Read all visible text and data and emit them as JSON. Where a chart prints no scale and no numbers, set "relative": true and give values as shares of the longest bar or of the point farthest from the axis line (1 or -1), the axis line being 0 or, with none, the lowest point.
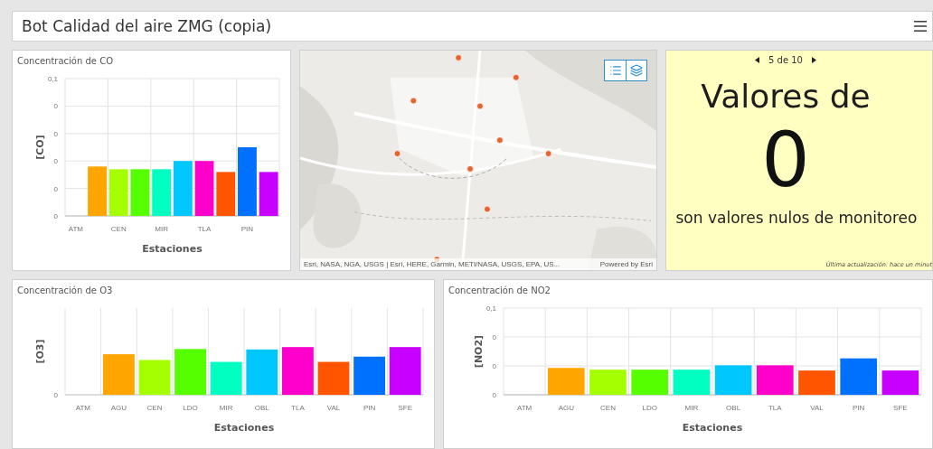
{
  "header": {
    "title": "Bot Calidad del aire ZMG (copia)"
  },
  "co_chart": {
    "title": "Concentración de CO",
    "chart_data": {
      "type": "bar",
      "xlabel": "Estaciones",
      "ylabel": "[CO]",
      "categories": [
        "ATM",
        null,
        "CEN",
        null,
        "MIR",
        null,
        "TLA",
        null,
        "PIN",
        null
      ],
      "series": [
        {
          "colors": [
            null,
            "#ffa500",
            "#a6ff00",
            "#55ff00",
            "#00ffc0",
            "#00c8ff",
            "#ff00cc",
            "#ff5500",
            "#0070ff",
            "#c800ff"
          ],
          "values": [
            null,
            0.036,
            0.034,
            0.034,
            0.034,
            0.04,
            0.04,
            0.032,
            0.05,
            0.032
          ]
        }
      ],
      "ylim": [
        0,
        0.1
      ],
      "yticks": [
        {
          "value": 0,
          "label": "0"
        },
        {
          "value": 0.02,
          "label": "0"
        },
        {
          "value": 0.04,
          "label": "0"
        },
        {
          "value": 0.06,
          "label": "0"
        },
        {
          "value": 0.08,
          "label": "0"
        },
        {
          "value": 0.1,
          "label": "0,1"
        }
      ],
      "grid": true
    }
  },
  "map": {
    "attribution": "Esri, NASA, NGA, USGS | Esri, HERE, Garmin, METI/NASA, USGS, EPA, US...",
    "powered_by": "Powered by Esri"
  },
  "indicator": {
    "pager": "5 de 10",
    "top_text": "Valores de",
    "value": "0",
    "bottom_text": "son valores nulos de monitoreo",
    "last_update": "Última actualización: hace un minut"
  },
  "o3_chart": {
    "title": "Concentración de O3",
    "chart_data": {
      "type": "bar",
      "xlabel": "Estaciones",
      "ylabel": "[O3]",
      "relative": true,
      "categories": [
        "ATM",
        "AGU",
        "CEN",
        "LDO",
        "MIR",
        "OBL",
        "TLA",
        "VAL",
        "PIN",
        "SFE"
      ],
      "series": [
        {
          "colors": [
            null,
            "#ffa500",
            "#a6ff00",
            "#55ff00",
            "#00ffc0",
            "#00c8ff",
            "#ff00cc",
            "#ff5500",
            "#0070ff",
            "#c800ff"
          ],
          "values": [
            null,
            0.85,
            0.73,
            0.96,
            0.69,
            0.95,
            1,
            0.69,
            0.8,
            1
          ]
        }
      ],
      "annotations": [
        {
          "text": "0"
        }
      ],
      "grid": true
    }
  },
  "no2_chart": {
    "title": "Concentración de NO2",
    "chart_data": {
      "type": "bar",
      "xlabel": "Estaciones",
      "ylabel": "[NO2]",
      "categories": [
        "ATM",
        "AGU",
        "CEN",
        "LDO",
        "MIR",
        "OBL",
        "TLA",
        "VAL",
        "PIN",
        "SFE"
      ],
      "series": [
        {
          "colors": [
            null,
            "#ffa500",
            "#a6ff00",
            "#55ff00",
            "#00ffc0",
            "#00c8ff",
            "#ff00cc",
            "#ff5500",
            "#0070ff",
            "#c800ff"
          ],
          "values": [
            null,
            0.031,
            0.029,
            0.029,
            0.029,
            0.034,
            0.034,
            0.028,
            0.042,
            0.028
          ]
        }
      ],
      "ylim": [
        0,
        0.1
      ],
      "yticks": [
        {
          "value": 0,
          "label": "0"
        },
        {
          "value": 0.0333,
          "label": "0"
        },
        {
          "value": 0.0667,
          "label": "0"
        },
        {
          "value": 0.1,
          "label": "0,1"
        }
      ],
      "grid": true
    }
  }
}
